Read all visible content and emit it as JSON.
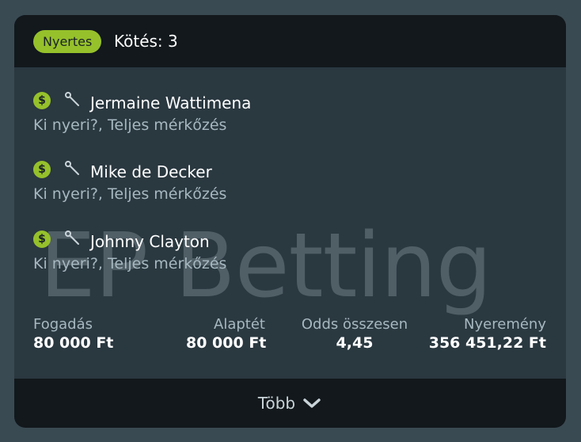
{
  "header": {
    "status_badge": "Nyertes",
    "bets_label": "Kötés: 3"
  },
  "watermark": "EP Betting",
  "selections": [
    {
      "player": "Jermaine Wattimena",
      "market": "Ki nyeri?, Teljes mérkőzés",
      "icon": "dollar-icon"
    },
    {
      "player": "Mike de Decker",
      "market": "Ki nyeri?, Teljes mérkőzés",
      "icon": "dollar-icon"
    },
    {
      "player": "Johnny Clayton",
      "market": "Ki nyeri?, Teljes mérkőzés",
      "icon": "dollar-icon"
    }
  ],
  "summary": {
    "stake_label": "Fogadás",
    "stake_value": "80 000 Ft",
    "base_label": "Alaptét",
    "base_value": "80 000 Ft",
    "odds_label": "Odds összesen",
    "odds_value": "4,45",
    "win_label": "Nyeremény",
    "win_value": "356 451,22 Ft"
  },
  "footer": {
    "more_label": "Több"
  },
  "colors": {
    "accent": "#96c12b",
    "card": "#2a3840",
    "header": "#12181c",
    "background": "#3a4a52"
  }
}
